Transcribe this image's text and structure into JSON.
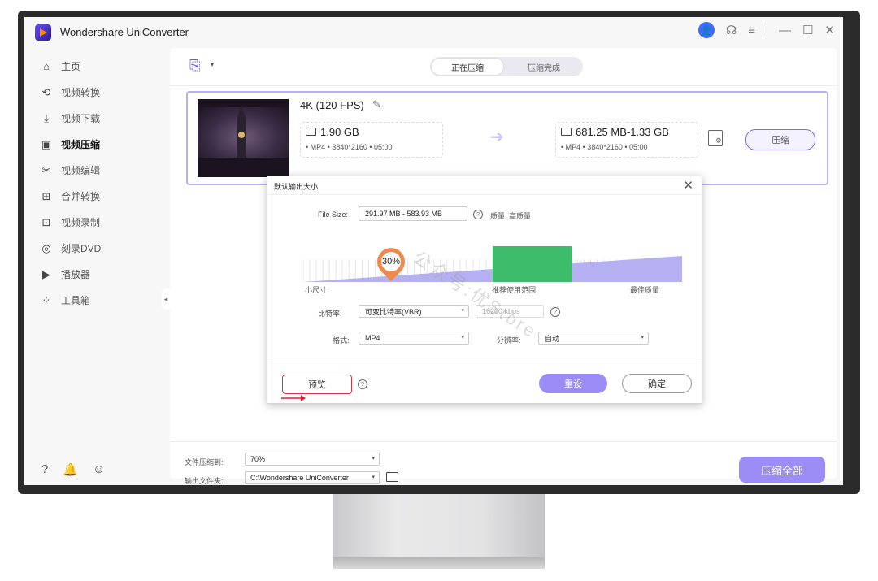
{
  "app": {
    "title": "Wondershare UniConverter"
  },
  "titlebar": {
    "avatar_glyph": "👤",
    "support_glyph": "☊",
    "menu_glyph": "≡",
    "min_glyph": "—",
    "max_glyph": "☐",
    "close_glyph": "✕"
  },
  "sidebar": {
    "items": [
      {
        "label": "主页",
        "icon": "home-icon",
        "glyph": "⌂"
      },
      {
        "label": "视频转换",
        "icon": "convert-icon",
        "glyph": "⟲"
      },
      {
        "label": "视频下载",
        "icon": "download-icon",
        "glyph": "⤓"
      },
      {
        "label": "视频压缩",
        "icon": "compress-icon",
        "glyph": "▣"
      },
      {
        "label": "视频编辑",
        "icon": "scissors-icon",
        "glyph": "✂"
      },
      {
        "label": "合并转换",
        "icon": "merge-icon",
        "glyph": "⊞"
      },
      {
        "label": "视频录制",
        "icon": "record-icon",
        "glyph": "⊡"
      },
      {
        "label": "刻录DVD",
        "icon": "dvd-icon",
        "glyph": "◎"
      },
      {
        "label": "播放器",
        "icon": "player-icon",
        "glyph": "▶"
      },
      {
        "label": "工具箱",
        "icon": "toolbox-icon",
        "glyph": "⁘"
      }
    ],
    "active_index": 3,
    "collapse_glyph": "◂",
    "bottom_glyphs": {
      "help": "?",
      "bell": "🔔",
      "feedback": "☺"
    }
  },
  "tabs": {
    "compressing": "正在压缩",
    "done": "压缩完成"
  },
  "toolbar": {
    "add_glyph": "⎘",
    "add_caret": "▾"
  },
  "file": {
    "resolution": "4K (120 FPS)",
    "edit_glyph": "✎",
    "src_size": "1.90 GB",
    "src_meta": "• MP4  • 3840*2160  • 05:00",
    "dst_size": "681.25 MB-1.33 GB",
    "dst_meta": "• MP4  • 3840*2160  • 05:00",
    "arrow_glyph": "➔",
    "settings_glyph": "⚙",
    "compress_label": "压缩"
  },
  "dialog": {
    "title": "默认输出大小",
    "close_glyph": "✕",
    "file_size_label": "File Size:",
    "file_size_value": "291.97 MB - 583.93 MB",
    "help_glyph": "?",
    "quality_text": "质量:   高质量",
    "slider": {
      "percent_label": "30%",
      "value_pct": 30,
      "small_label": "小尺寸",
      "recommend_label": "推荐使用范围",
      "best_label": "最佳质量",
      "recommend_range_pct": [
        50,
        71
      ]
    },
    "bitrate_label": "比特率:",
    "bitrate_value": "可变比特率(VBR)",
    "kbps_placeholder": "16200 kbps",
    "format_label": "格式:",
    "format_value": "MP4",
    "resolution_label": "分辨率:",
    "resolution_value": "自动",
    "preview_label": "预览",
    "reset_label": "重设",
    "ok_label": "确定"
  },
  "bottom": {
    "ratio_label": "文件压缩到:",
    "ratio_value": "70%",
    "output_label": "输出文件夹:",
    "output_value": "C:\\Wondershare UniConverter",
    "compress_all_label": "压缩全部"
  },
  "watermark": "公众号:优Store",
  "colors": {
    "accent": "#9c8cf6",
    "pin": "#f08a4b",
    "range": "#3dbd6b",
    "alert": "#d9364b"
  }
}
